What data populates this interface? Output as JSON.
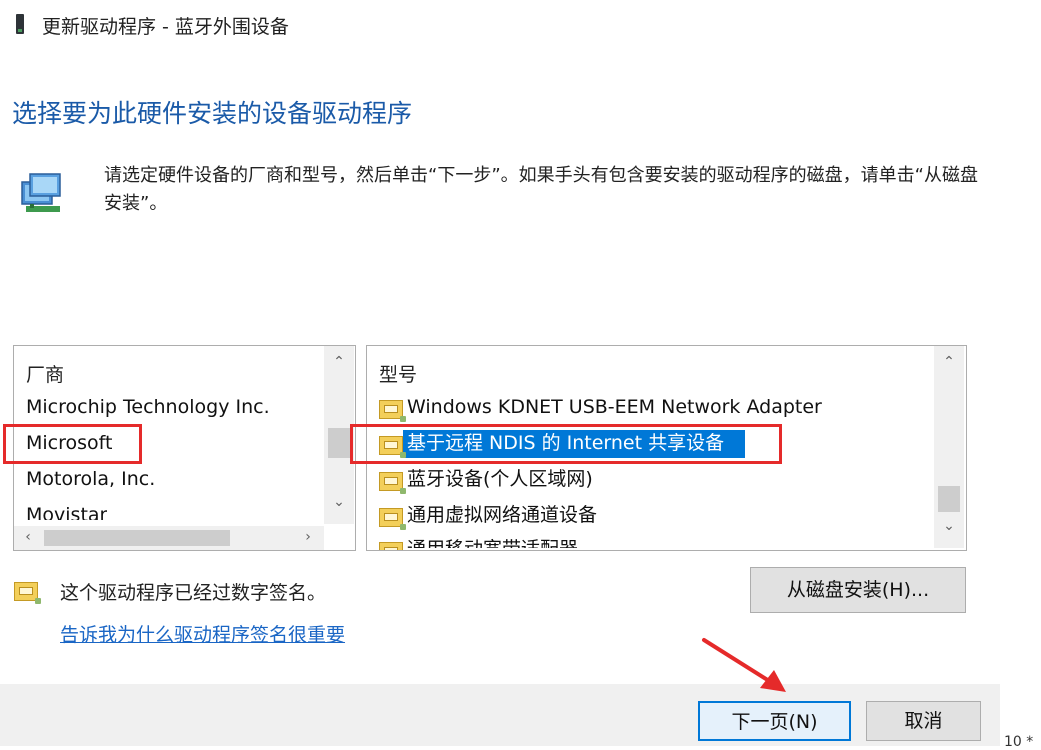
{
  "window": {
    "title": "更新驱动程序 - 蓝牙外围设备"
  },
  "heading": "选择要为此硬件安装的设备驱动程序",
  "instructions": "请选定硬件设备的厂商和型号，然后单击“下一步”。如果手头有包含要安装的驱动程序的磁盘，请单击“从磁盘安装”。",
  "manufacturer_list": {
    "header": "厂商",
    "items": [
      {
        "label": "Microchip Technology Inc."
      },
      {
        "label": "Microsoft"
      },
      {
        "label": "Motorola, Inc."
      },
      {
        "label": "Movistar"
      }
    ],
    "selected": "Microsoft"
  },
  "model_list": {
    "header": "型号",
    "items": [
      {
        "label": "Windows KDNET USB-EEM Network Adapter"
      },
      {
        "label": "基于远程 NDIS 的 Internet 共享设备"
      },
      {
        "label": "蓝牙设备(个人区域网)"
      },
      {
        "label": "通用虚拟网络通道设备"
      },
      {
        "label": "通用移动宽带适配器"
      }
    ],
    "selected": "基于远程 NDIS 的 Internet 共享设备"
  },
  "signature": {
    "text": "这个驱动程序已经过数字签名。",
    "link": "告诉我为什么驱动程序签名很重要"
  },
  "buttons": {
    "have_disk": "从磁盘安装(H)...",
    "next": "下一页(N)",
    "cancel": "取消"
  },
  "colors": {
    "accent": "#0078d7",
    "heading": "#1a5aa8",
    "annotation": "#e52a2a"
  },
  "corner_text": "10 *"
}
